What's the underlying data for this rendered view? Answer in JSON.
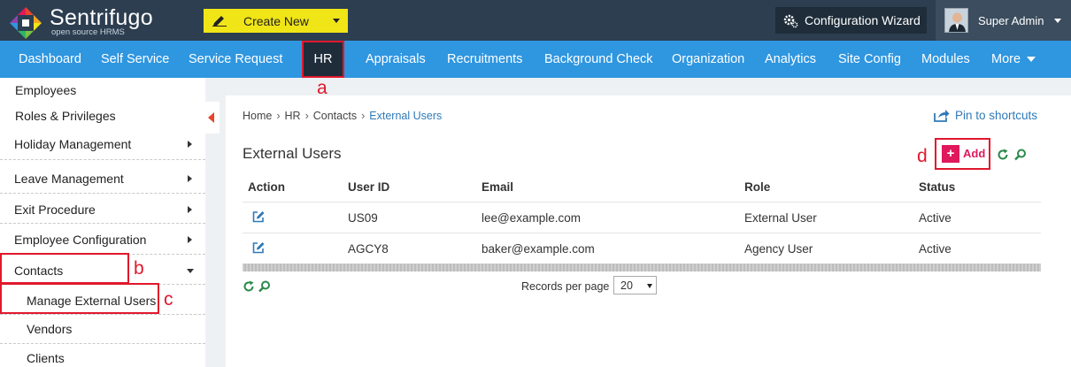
{
  "header": {
    "brand_name": "Sentrifugo",
    "brand_tagline": "open source HRMS",
    "create_new_label": "Create New",
    "config_wizard_label": "Configuration Wizard",
    "user_name": "Super Admin"
  },
  "nav": {
    "items": [
      "Dashboard",
      "Self Service",
      "Service Request",
      "HR",
      "Appraisals",
      "Recruitments",
      "Background Check",
      "Organization",
      "Analytics",
      "Site Config",
      "Modules",
      "More"
    ],
    "active": "HR"
  },
  "sidebar": {
    "items": [
      "Employees",
      "Roles & Privileges",
      "Holiday Management",
      "Leave Management",
      "Exit Procedure",
      "Employee Configuration",
      "Contacts",
      "Manage External Users",
      "Vendors",
      "Clients"
    ]
  },
  "markers": {
    "a": "a",
    "b": "b",
    "c": "c",
    "d": "d"
  },
  "breadcrumb": [
    "Home",
    "HR",
    "Contacts",
    "External Users"
  ],
  "breadcrumb_sep": "›",
  "pin_label": "Pin to shortcuts",
  "main": {
    "title": "External Users",
    "add_label": "Add",
    "add_symbol": "+"
  },
  "table": {
    "columns": [
      "Action",
      "User ID",
      "Email",
      "Role",
      "Status"
    ],
    "rows": [
      {
        "user_id": "US09",
        "email": "lee@example.com",
        "role": "External User",
        "status": "Active"
      },
      {
        "user_id": "AGCY8",
        "email": "baker@example.com",
        "role": "Agency User",
        "status": "Active"
      }
    ]
  },
  "pagination": {
    "records_label": "Records per page",
    "records_value": "20"
  },
  "colors": {
    "topbar": "#2c3e50",
    "nav": "#2f96e0",
    "highlight": "#e0182c",
    "add": "#e0185c",
    "create_new": "#f0e517",
    "link": "#2f7ab8"
  },
  "icons": [
    "pencil-icon",
    "gear-icon",
    "caret-down-icon",
    "share-icon",
    "refresh-icon",
    "search-icon",
    "edit-icon"
  ]
}
